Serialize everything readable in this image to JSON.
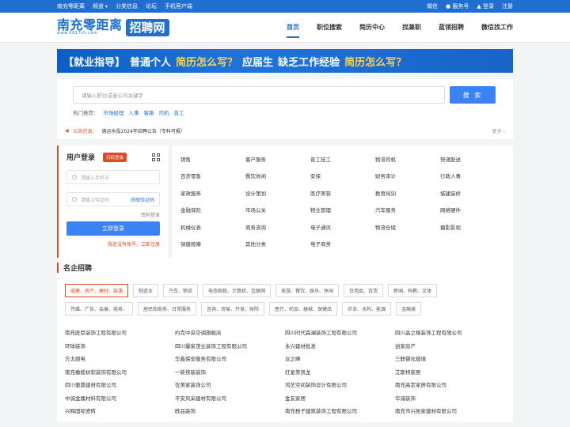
{
  "topbar": {
    "left": [
      "南充零距离",
      "频道",
      "分类信息",
      "论坛",
      "手机客户端"
    ],
    "right": [
      "微信",
      "服务号",
      "登录",
      "注册"
    ]
  },
  "logo": {
    "name": "南充零距离",
    "site": "www.0817ch.com",
    "badge": "招聘网"
  },
  "nav": [
    "首页",
    "职位搜索",
    "简历中心",
    "找兼职",
    "蓝领招聘",
    "微信找工作"
  ],
  "banner": [
    "【就业指导】",
    "普通个人",
    "简历怎么写？",
    "应届生",
    "缺乏工作经验",
    "简历怎么写？"
  ],
  "search": {
    "placeholder": "请输入职位或者公司关键字",
    "button": "搜 索",
    "hot_label": "热门推荐：",
    "hot": [
      "市场经理",
      "人事",
      "客服",
      "司机",
      "普工"
    ]
  },
  "notice": {
    "label": "公告信息：",
    "text": "德运水投2024年招聘公告（专科可报）",
    "more": "更多 ›"
  },
  "login": {
    "title": "用户登录",
    "tag": "扫码登录",
    "phone_placeholder": "请输入手机号",
    "code_placeholder": "请输入验证码",
    "get_code": "获取验证码",
    "pwd_login": "密码登录",
    "button": "立即登录",
    "register": "我还没有账号，立即注册"
  },
  "categories": [
    "销售",
    "客户服务",
    "普工技工",
    "物流司机",
    "快递配送",
    "百货零售",
    "餐饮休闲",
    "安保",
    "财务审计",
    "行政人事",
    "家政服务",
    "设计策划",
    "医疗美容",
    "教育培训",
    "城建装修",
    "金融保险",
    "市场公关",
    "物业管理",
    "汽车服务",
    "网络硬件",
    "机械仪表",
    "商务咨询",
    "电子通讯",
    "物流仓储",
    "摄影影视",
    "保健按摩",
    "其他分类",
    "电子商务"
  ],
  "famous": {
    "title": "名企招聘",
    "tags": [
      "城建、房产、建材、装潢",
      "制造业",
      "汽车、物流",
      "电信邮政、计算机、互联网",
      "旅游、餐饮、娱乐、休闲",
      "日用品、百货",
      "新闻、科教、文体",
      "传媒、广告、会展、商务、",
      "居民和商务、日常服务",
      "咨询、贸易、开发、财险",
      "医疗、药品、器械、保健品",
      "农业、水利、能源",
      "金融类"
    ],
    "companies": [
      "南充匠臣装饰工程有限公司",
      "约克中央空调旗舰店",
      "四川时代森澜装饰工程有限公司",
      "四川晶之格装饰工程有限公司",
      "环球装饰",
      "四川馨家茂业装饰工程有限公司",
      "永兴建材批发",
      "逍家房产",
      "方太厨电",
      "华鑫保安服务有限公司",
      "业之峰",
      "三联钢化玻璃",
      "南充橄榄树软装饰有限公司",
      "一新快装装饰",
      "红星美凯龙",
      "艾斯特家居",
      "四川衡鼎建材有限公司",
      "优美家装饰公司",
      "鸿艺空间装饰设计有限公司",
      "南充高定家居有限公司",
      "中诚金属材料有限公司",
      "平安风采建材有限公司",
      "金友家居",
      "华诚装饰",
      "兴辉国际瓷砖",
      "欧品装饰",
      "南充橙子建筑装饰工程有限公司",
      "南充市兴祐家建材有限公司"
    ]
  }
}
